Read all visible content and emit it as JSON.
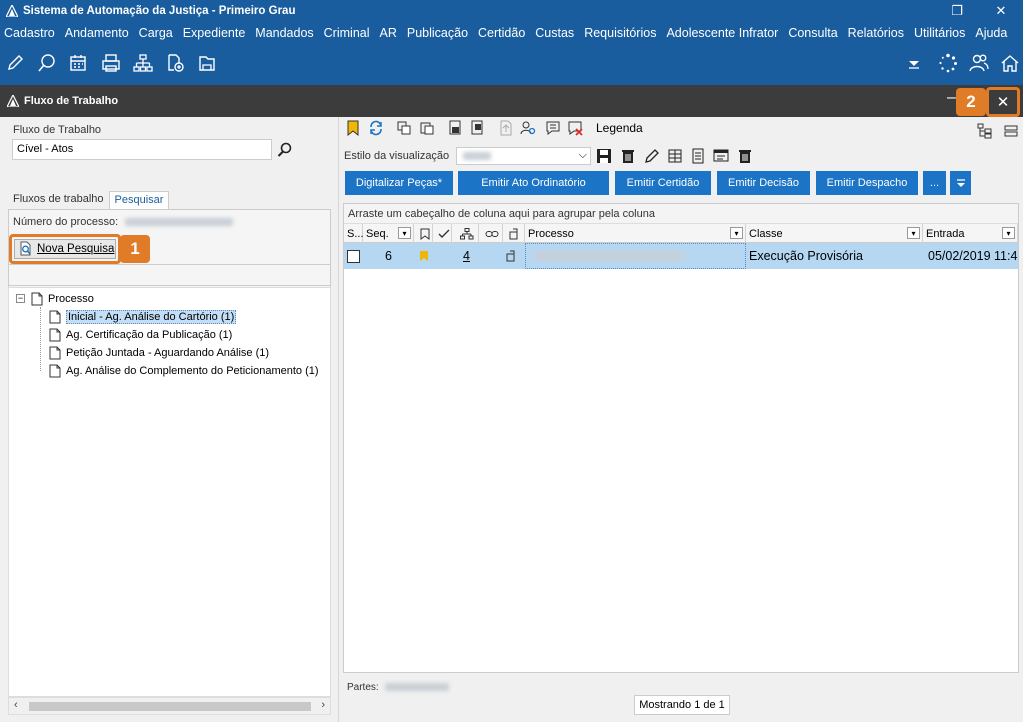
{
  "window": {
    "title": "Sistema de Automação da Justiça - Primeiro Grau",
    "restore_glyph": "❐",
    "close_glyph": "✕"
  },
  "menu": [
    "Cadastro",
    "Andamento",
    "Carga",
    "Expediente",
    "Mandados",
    "Criminal",
    "AR",
    "Publicação",
    "Certidão",
    "Custas",
    "Requisitórios",
    "Adolescente Infrator",
    "Consulta",
    "Relatórios",
    "Utilitários",
    "Ajuda"
  ],
  "toolbar": {
    "left_icons": [
      "edit-icon",
      "search-chat-icon",
      "calendar-icon",
      "printer-icon",
      "org-chart-icon",
      "add-document-icon",
      "folder-icon"
    ],
    "right_icons": [
      "dropdown-arrow-icon",
      "spinner-icon",
      "users-icon",
      "home-icon"
    ]
  },
  "workflow": {
    "title": "Fluxo de Trabalho",
    "min_glyph": "–",
    "close_glyph": "✕",
    "badge_close": "2"
  },
  "left": {
    "flow_label": "Fluxo de Trabalho",
    "flow_value": "Cível - Atos",
    "tabs": [
      "Fluxos de trabalho",
      "Pesquisar"
    ],
    "process_number_label": "Número do processo:",
    "new_search_label": "Nova Pesquisa",
    "badge_new_search": "1",
    "tree": {
      "root": "Processo",
      "expander": "−",
      "items": [
        "Inicial - Ag. Análise do Cartório (1)",
        "Ag. Certificação da Publicação (1)",
        "Petição Juntada - Aguardando Análise (1)",
        "Ag. Análise do Complemento do Peticionamento (1)"
      ]
    },
    "scroll_left": "‹",
    "scroll_right": "›"
  },
  "right": {
    "legend_label": "Legenda",
    "view_style_label": "Estilo da visualização",
    "dropdown_glyph": "⌵",
    "actions": [
      "Digitalizar Peças*",
      "Emitir Ato Ordinatório",
      "Emitir Certidão",
      "Emitir Decisão",
      "Emitir Despacho",
      "..."
    ],
    "group_hint": "Arraste um cabeçalho de coluna aqui para agrupar pela coluna",
    "columns": [
      "S...",
      "Seq.",
      "",
      "",
      "",
      "",
      "",
      "Processo",
      "Classe",
      "Entrada"
    ],
    "row": {
      "seq": "6",
      "count": "4",
      "classe": "Execução Provisória",
      "entrada": "05/02/2019 11:4"
    },
    "partes_label": "Partes:",
    "status": "Mostrando 1 de 1"
  }
}
